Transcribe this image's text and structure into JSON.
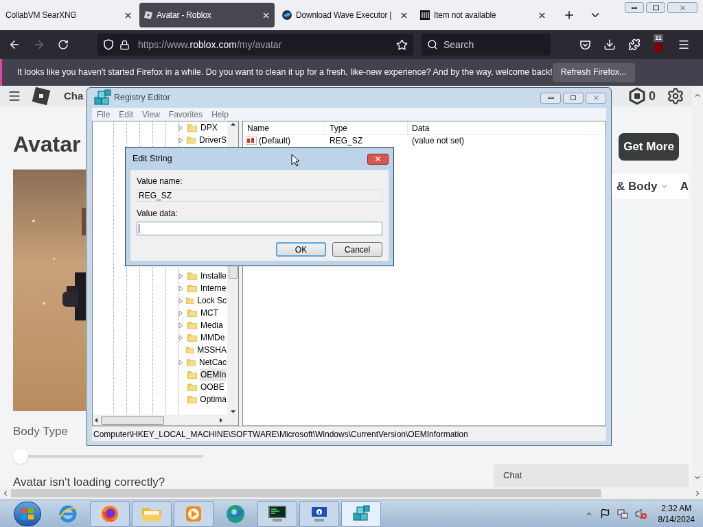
{
  "browser": {
    "tabs": [
      {
        "title": "CollabVM SearXNG",
        "selected": false
      },
      {
        "title": "Avatar - Roblox",
        "selected": true
      },
      {
        "title": "Download Wave Executor |",
        "selected": false
      },
      {
        "title": "Item not available",
        "selected": false
      }
    ],
    "address": {
      "scheme": "https://www.",
      "domain": "roblox.com",
      "path": "/my/avatar"
    },
    "forward_disabled": true,
    "search_placeholder": "Search",
    "extension_badge": "11",
    "notification": {
      "message": "It looks like you haven't started Firefox in a while. Do you want to clean it up for a fresh, like-new experience? And by the way, welcome back!",
      "button": "Refresh Firefox..."
    }
  },
  "page": {
    "nav_partial": "Cha",
    "robux": "0",
    "heading": "Avatar",
    "get_more": "Get More",
    "category": "& Body",
    "category_next": "A",
    "body_type": {
      "label": "Body Type",
      "level": 0
    },
    "help_text": "Avatar isn't loading correctly?",
    "chat": "Chat"
  },
  "registry_editor": {
    "title": "Registry Editor",
    "menu": [
      "File",
      "Edit",
      "View",
      "Favorites",
      "Help"
    ],
    "tree_top": [
      {
        "label": "DPX",
        "expandable": true,
        "selected": false
      },
      {
        "label": "DriverS",
        "expandable": true,
        "selected": false
      }
    ],
    "tree_bottom": [
      {
        "label": "Installe",
        "expandable": true,
        "selected": false
      },
      {
        "label": "Interne",
        "expandable": true,
        "selected": false
      },
      {
        "label": "Lock Sc",
        "expandable": true,
        "selected": false
      },
      {
        "label": "MCT",
        "expandable": true,
        "selected": false
      },
      {
        "label": "Media",
        "expandable": true,
        "selected": false
      },
      {
        "label": "MMDe",
        "expandable": true,
        "selected": false
      },
      {
        "label": "MSSHA",
        "expandable": false,
        "selected": false
      },
      {
        "label": "NetCac",
        "expandable": true,
        "selected": false
      },
      {
        "label": "OEMIn",
        "expandable": false,
        "selected": true
      },
      {
        "label": "OOBE",
        "expandable": false,
        "selected": false
      },
      {
        "label": "Optima",
        "expandable": false,
        "selected": false
      }
    ],
    "columns": [
      "Name",
      "Type",
      "Data"
    ],
    "rows": [
      {
        "name": "(Default)",
        "type": "REG_SZ",
        "data": "(value not set)"
      }
    ],
    "status": "Computer\\HKEY_LOCAL_MACHINE\\SOFTWARE\\Microsoft\\Windows\\CurrentVersion\\OEMInformation"
  },
  "dialog": {
    "title": "Edit String",
    "value_name_label": "Value name:",
    "value_name": "REG_SZ",
    "value_data_label": "Value data:",
    "buttons": [
      {
        "label": "OK",
        "default": true
      },
      {
        "label": "Cancel",
        "default": false
      }
    ]
  },
  "taskbar": {
    "apps": [
      {
        "kind": "ie",
        "running": false,
        "active": false
      },
      {
        "kind": "firefox",
        "running": true,
        "active": false
      },
      {
        "kind": "explorer",
        "running": true,
        "active": false
      },
      {
        "kind": "media",
        "running": true,
        "active": false
      },
      {
        "kind": "globe",
        "running": false,
        "active": false
      },
      {
        "kind": "terminal",
        "running": true,
        "active": false
      },
      {
        "kind": "info",
        "running": true,
        "active": false
      },
      {
        "kind": "regedit",
        "running": true,
        "active": true
      }
    ],
    "time": "2:32 AM",
    "date": "8/14/2024"
  }
}
